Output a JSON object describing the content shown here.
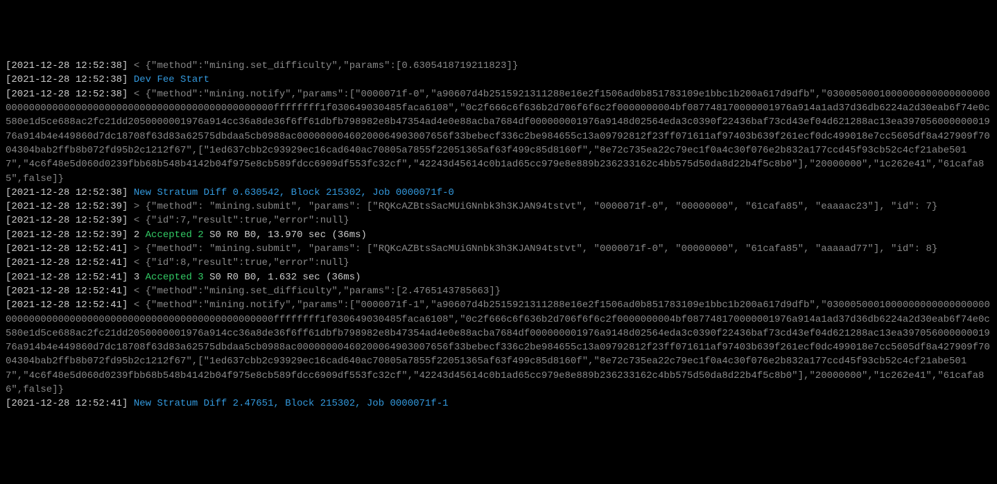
{
  "lines": [
    {
      "ts": "[2021-12-28 12:52:38]",
      "arrow": "<",
      "json": "{\"method\":\"mining.set_difficulty\",\"params\":[0.6305418719211823]}"
    },
    {
      "ts": "[2021-12-28 12:52:38]",
      "msg": "Dev Fee Start"
    },
    {
      "ts": "[2021-12-28 12:52:38]",
      "arrow": "<",
      "json": "{\"method\":\"mining.notify\",\"params\":[\"0000071f-0\",\"a90607d4b2515921311288e16e2f1506ad0b851783109e1bbc1b200a617d9dfb\",\"03000500010000000000000000000000000000000000000000000000000000000000000000ffffffff1f030649030485faca6108\",\"0c2f666c6f636b2d706f6f6c2f0000000004bf087748170000001976a914a1ad37d36db6224a2d30eab6f74e0c580e1d5ce688ac2fc21dd2050000001976a914cc36a8de36f6ff61dbfb798982e8b47354ad4e0e88acba7684df000000001976a9148d02564eda3c0390f22436baf73cd43ef04d621288ac13ea39705600000001976a914b4e449860d7dc18708f63d83a62575dbdaa5cb0988ac00000000460200064903007656f33bebecf336c2be984655c13a09792812f23ff071611af97403b639f261ecf0dc499018e7cc5605df8a427909f7004304bab2ffb8b072fd95b2c1212f67\",[\"1ed637cbb2c93929ec16cad640ac70805a7855f22051365af63f499c85d8160f\",\"8e72c735ea22c79ec1f0a4c30f076e2b832a177ccd45f93cb52c4cf21abe5017\",\"4c6f48e5d060d0239fbb68b548b4142b04f975e8cb589fdcc6909df553fc32cf\",\"42243d45614c0b1ad65cc979e8e889b236233162c4bb575d50da8d22b4f5c8b0\"],\"20000000\",\"1c262e41\",\"61cafa85\",false]}"
    },
    {
      "ts": "[2021-12-28 12:52:38]",
      "msg": "New Stratum Diff 0.630542, Block 215302, Job 0000071f-0"
    },
    {
      "ts": "[2021-12-28 12:52:39]",
      "arrow": ">",
      "json": "{\"method\": \"mining.submit\", \"params\": [\"RQKcAZBtsSacMUiGNnbk3h3KJAN94tstvt\", \"0000071f-0\", \"00000000\", \"61cafa85\", \"eaaaac23\"], \"id\": 7}"
    },
    {
      "ts": "[2021-12-28 12:52:39]",
      "arrow": "<",
      "json": "{\"id\":7,\"result\":true,\"error\":null}"
    },
    {
      "ts": "[2021-12-28 12:52:39]",
      "num1": "2",
      "accepted": "Accepted 2",
      "rest": " S0 R0 B0, 13.970 sec (36ms)"
    },
    {
      "ts": "[2021-12-28 12:52:41]",
      "arrow": ">",
      "json": "{\"method\": \"mining.submit\", \"params\": [\"RQKcAZBtsSacMUiGNnbk3h3KJAN94tstvt\", \"0000071f-0\", \"00000000\", \"61cafa85\", \"aaaaad77\"], \"id\": 8}"
    },
    {
      "ts": "[2021-12-28 12:52:41]",
      "arrow": "<",
      "json": "{\"id\":8,\"result\":true,\"error\":null}"
    },
    {
      "ts": "[2021-12-28 12:52:41]",
      "num1": "3",
      "accepted": "Accepted 3",
      "rest": " S0 R0 B0, 1.632 sec (36ms)"
    },
    {
      "ts": "[2021-12-28 12:52:41]",
      "arrow": "<",
      "json": "{\"method\":\"mining.set_difficulty\",\"params\":[2.4765143785663]}"
    },
    {
      "ts": "[2021-12-28 12:52:41]",
      "arrow": "<",
      "json": "{\"method\":\"mining.notify\",\"params\":[\"0000071f-1\",\"a90607d4b2515921311288e16e2f1506ad0b851783109e1bbc1b200a617d9dfb\",\"03000500010000000000000000000000000000000000000000000000000000000000000000ffffffff1f030649030485faca6108\",\"0c2f666c6f636b2d706f6f6c2f0000000004bf087748170000001976a914a1ad37d36db6224a2d30eab6f74e0c580e1d5ce688ac2fc21dd2050000001976a914cc36a8de36f6ff61dbfb798982e8b47354ad4e0e88acba7684df000000001976a9148d02564eda3c0390f22436baf73cd43ef04d621288ac13ea39705600000001976a914b4e449860d7dc18708f63d83a62575dbdaa5cb0988ac00000000460200064903007656f33bebecf336c2be984655c13a09792812f23ff071611af97403b639f261ecf0dc499018e7cc5605df8a427909f7004304bab2ffb8b072fd95b2c1212f67\",[\"1ed637cbb2c93929ec16cad640ac70805a7855f22051365af63f499c85d8160f\",\"8e72c735ea22c79ec1f0a4c30f076e2b832a177ccd45f93cb52c4cf21abe5017\",\"4c6f48e5d060d0239fbb68b548b4142b04f975e8cb589fdcc6909df553fc32cf\",\"42243d45614c0b1ad65cc979e8e889b236233162c4bb575d50da8d22b4f5c8b0\"],\"20000000\",\"1c262e41\",\"61cafa86\",false]}"
    },
    {
      "ts": "[2021-12-28 12:52:41]",
      "msg": "New Stratum Diff 2.47651, Block 215302, Job 0000071f-1"
    }
  ]
}
